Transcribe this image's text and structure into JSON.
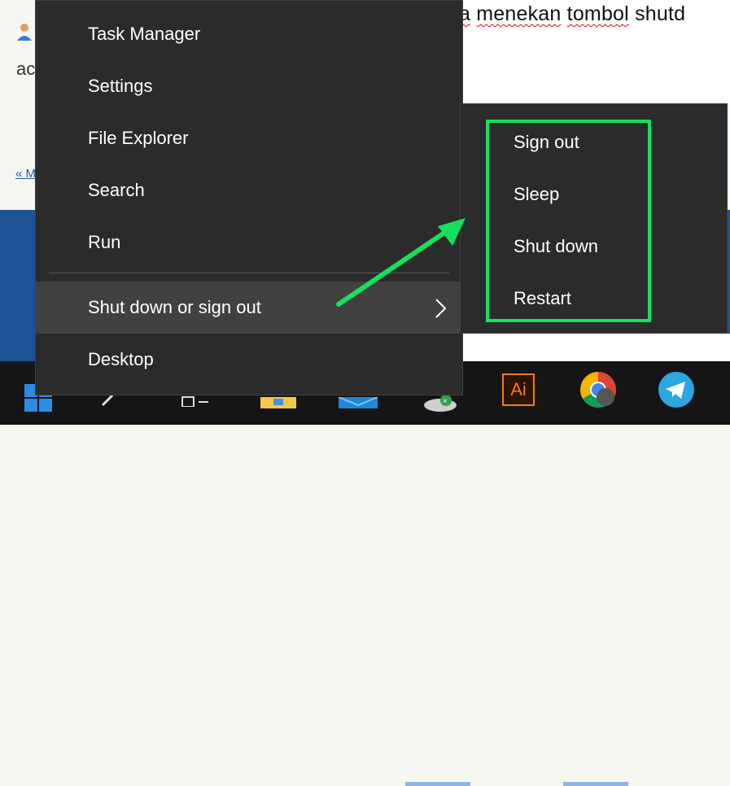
{
  "background_doc": {
    "line_prefix": "a",
    "line_word_1": "menekan",
    "line_word_2": "tombol",
    "line_word_3": "shutd",
    "fragment_ac": "ac",
    "fragment_link": "« M"
  },
  "context_menu": {
    "items": [
      {
        "label": "Task Manager"
      },
      {
        "label": "Settings"
      },
      {
        "label": "File Explorer"
      },
      {
        "label": "Search"
      },
      {
        "label": "Run"
      },
      {
        "label": "Shut down or sign out"
      },
      {
        "label": "Desktop"
      }
    ],
    "active_item": "Shut down or sign out"
  },
  "submenu": {
    "items": [
      {
        "label": "Sign out"
      },
      {
        "label": "Sleep"
      },
      {
        "label": "Shut down"
      },
      {
        "label": "Restart"
      }
    ]
  },
  "annotation": {
    "highlight_color": "#16e060",
    "arrow_color": "#16e060"
  },
  "taskbar": {
    "icons": [
      "windows-start-icon",
      "search-icon",
      "task-view-icon",
      "file-explorer-icon",
      "mail-icon",
      "network-app-icon",
      "adobe-illustrator-icon",
      "chrome-icon",
      "telegram-icon"
    ],
    "illustrator_label": "Ai"
  },
  "colors": {
    "menu_bg": "#2b2b2b",
    "menu_active_bg": "#414141",
    "taskbar_bg": "#151515",
    "desktop_blue": "#1d5294"
  }
}
